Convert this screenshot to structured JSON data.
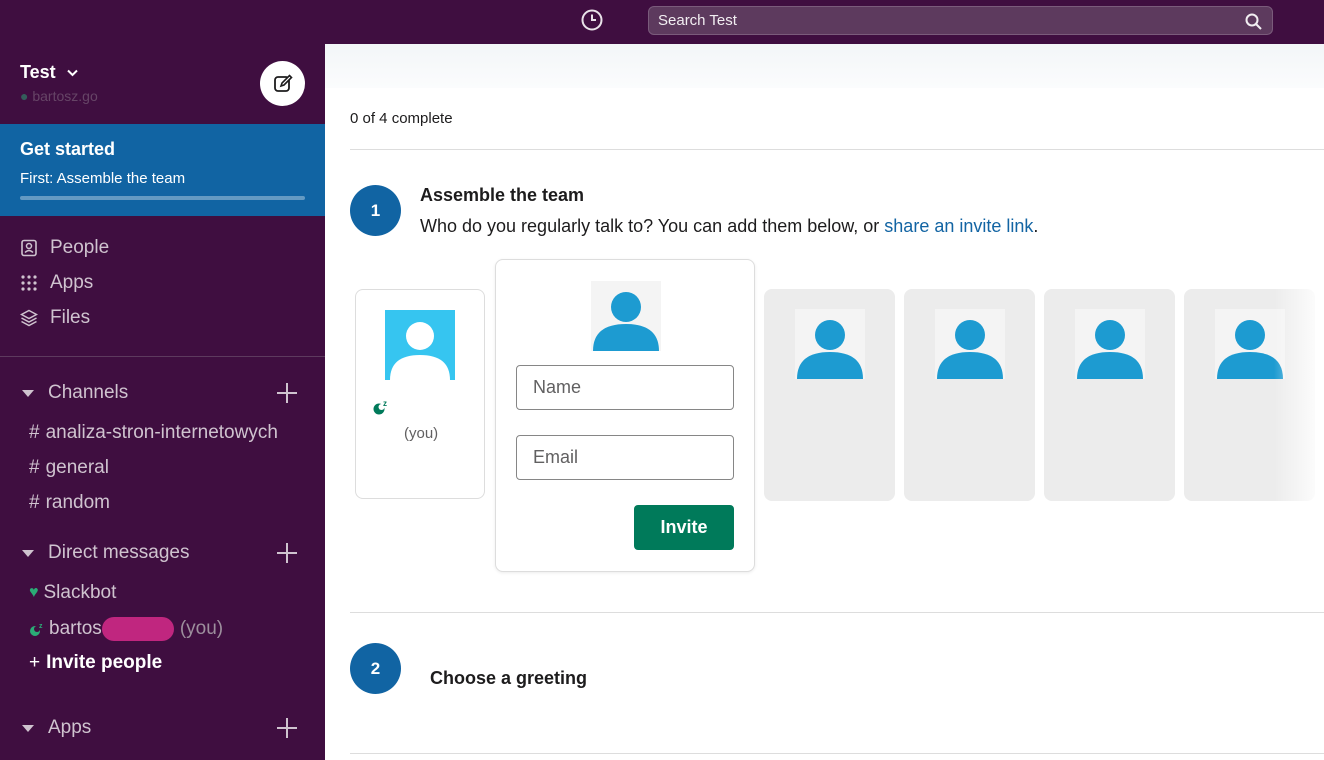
{
  "topbar": {
    "search_placeholder": "Search Test",
    "history_icon": "clock-icon",
    "search_icon": "magnifier-icon"
  },
  "sidebar": {
    "workspace_name": "Test",
    "workspace_user": "bartosz.go",
    "get_started": {
      "title": "Get started",
      "subtitle": "First: Assemble the team",
      "progress": 0
    },
    "nav": [
      {
        "label": "People",
        "icon": "people-icon"
      },
      {
        "label": "Apps",
        "icon": "apps-grid-icon"
      },
      {
        "label": "Files",
        "icon": "files-layers-icon"
      }
    ],
    "channels_label": "Channels",
    "channels": [
      "analiza-stron-internetowych",
      "general",
      "random"
    ],
    "dm_label": "Direct messages",
    "dms": [
      {
        "name": "Slackbot",
        "suffix": ""
      },
      {
        "name": "bartos",
        "suffix": "(you)"
      }
    ],
    "invite_people": "Invite people",
    "apps_label": "Apps"
  },
  "main": {
    "progress_count": "0 of 4",
    "progress_suffix": " complete",
    "step1": {
      "number": "1",
      "title": "Assemble the team",
      "desc_prefix": "Who do you regularly talk to? You can add them below, or ",
      "desc_link": "share an invite link",
      "desc_suffix": "."
    },
    "you_label": "(you)",
    "name_placeholder": "Name",
    "email_placeholder": "Email",
    "invite_button": "Invite",
    "step2": {
      "number": "2",
      "title": "Choose a greeting"
    }
  },
  "colors": {
    "sidebar_bg": "#3f0e40",
    "active_blue": "#1164a3",
    "invite_green": "#007a5a",
    "avatar_blue": "#1d9bd1"
  }
}
